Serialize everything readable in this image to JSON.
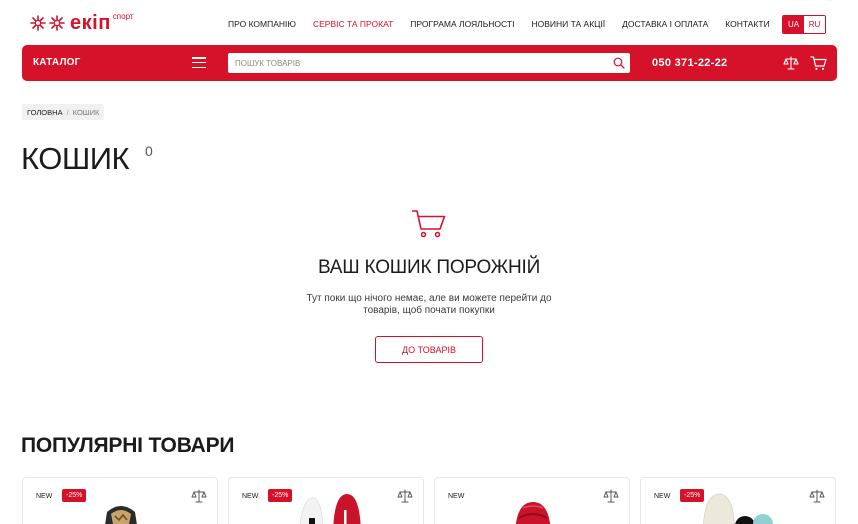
{
  "brand": {
    "name": "екіп",
    "sub": "спорт"
  },
  "nav": [
    {
      "label": "ПРО КОМПАНІЮ",
      "active": false
    },
    {
      "label": "СЕРВІС ТА ПРОКАТ",
      "active": true
    },
    {
      "label": "ПРОГРАМА ЛОЯЛЬНОСТІ",
      "active": false
    },
    {
      "label": "НОВИНИ ТА АКЦІЇ",
      "active": false
    },
    {
      "label": "ДОСТАВКА І ОПЛАТА",
      "active": false
    },
    {
      "label": "КОНТАКТИ",
      "active": false
    }
  ],
  "lang": {
    "ua": "UA",
    "ru": "RU",
    "selected": "UA"
  },
  "header": {
    "catalog": "КАТАЛОГ",
    "search_placeholder": "ПОШУК ТОВАРІВ",
    "phone": "050 371-22-22"
  },
  "breadcrumb": {
    "home": "ГОЛОВНА",
    "sep": "/",
    "current": "КОШИК"
  },
  "page": {
    "title": "КОШИК",
    "count": "0"
  },
  "empty": {
    "title": "ВАШ КОШИК ПОРОЖНІЙ",
    "text": "Тут поки що нічого немає, але ви можете перейти до товарів, щоб почати покупки",
    "button": "ДО ТОВАРІВ"
  },
  "popular": {
    "title": "ПОПУЛЯРНІ ТОВАРИ",
    "cards": [
      {
        "new": "NEW",
        "sale": "-25%"
      },
      {
        "new": "NEW",
        "sale": "-25%"
      },
      {
        "new": "NEW",
        "sale": ""
      },
      {
        "new": "NEW",
        "sale": "-25%"
      }
    ]
  },
  "colors": {
    "accent": "#d6112a",
    "text": "#1b1b1b",
    "muted": "#f1f1f1"
  }
}
